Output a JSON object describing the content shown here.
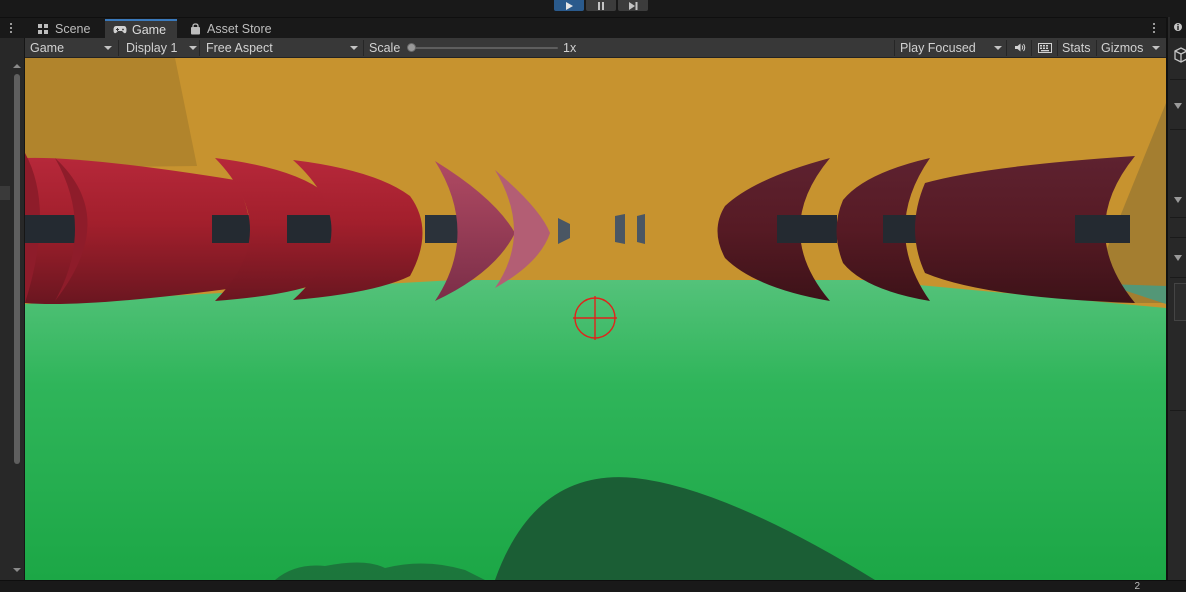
{
  "play_controls": {
    "play": "play-icon",
    "pause": "pause-icon",
    "step": "step-icon"
  },
  "tabs": [
    {
      "label": "Scene",
      "icon": "grid-icon",
      "active": false
    },
    {
      "label": "Game",
      "icon": "gamepad-icon",
      "active": true
    },
    {
      "label": "Asset Store",
      "icon": "bag-icon",
      "active": false
    }
  ],
  "toolbar": {
    "view_mode": "Game",
    "display": "Display 1",
    "aspect": "Free Aspect",
    "scale_label": "Scale",
    "scale_value": "1x",
    "scale_fraction": 0.0,
    "play_mode": "Play Focused",
    "stats": "Stats",
    "gizmos": "Gizmos"
  },
  "status": {
    "count": "2"
  },
  "colors": {
    "wall": "#c7932f",
    "floor": "#22ad4a",
    "accent": "#3a79bb",
    "crosshair": "#e0231b",
    "enemy_left": "#a11f2a",
    "enemy_right": "#5a1a22"
  }
}
